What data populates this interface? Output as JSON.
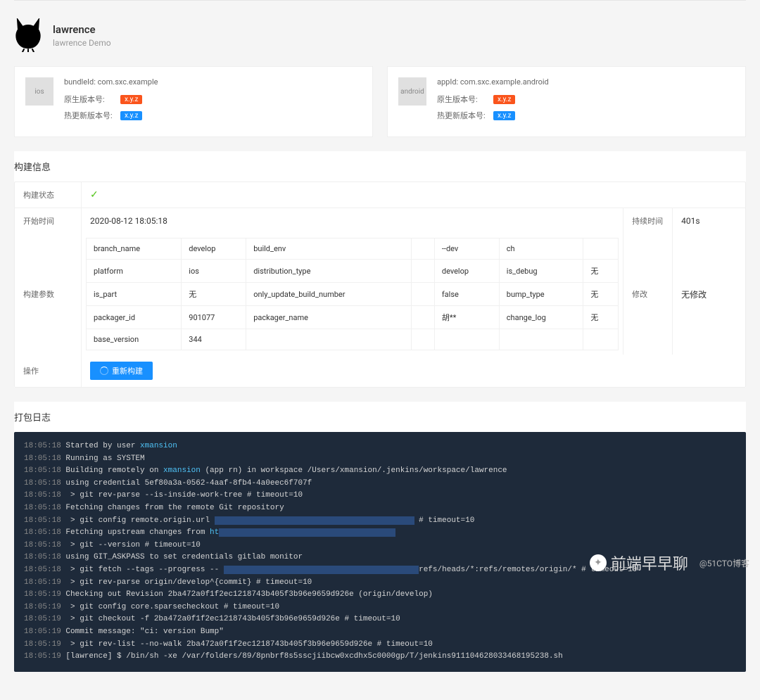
{
  "header": {
    "title": "lawrence",
    "subtitle": "lawrence Demo"
  },
  "platforms": {
    "ios": {
      "icon_label": "ios",
      "bundle_label": "bundleId: com.sxc.example",
      "native_version_label": "原生版本号:",
      "native_version_value": "x.y.z",
      "hot_version_label": "热更新版本号:",
      "hot_version_value": "x.y.z"
    },
    "android": {
      "icon_label": "android",
      "bundle_label": "appId: com.sxc.example.android",
      "native_version_label": "原生版本号:",
      "native_version_value": "x.y.z",
      "hot_version_label": "热更新版本号:",
      "hot_version_value": "x.y.z"
    }
  },
  "build_info": {
    "title": "构建信息",
    "status_label": "构建状态",
    "start_time_label": "开始时间",
    "start_time_value": "2020-08-12 18:05:18",
    "duration_label": "持续时间",
    "duration_value": "401s",
    "params_label": "构建参数",
    "changes_label": "修改",
    "changes_value": "无修改",
    "action_label": "操作",
    "rebuild_label": "重新构建",
    "params": [
      [
        "branch_name",
        "develop",
        "build_env",
        "",
        "--dev",
        "ch",
        ""
      ],
      [
        "platform",
        "ios",
        "distribution_type",
        "",
        "develop",
        "is_debug",
        "无"
      ],
      [
        "is_part",
        "无",
        "only_update_build_number",
        "",
        "false",
        "bump_type",
        "无"
      ],
      [
        "packager_id",
        "901077",
        "packager_name",
        "",
        "胡**",
        "change_log",
        "无"
      ],
      [
        "base_version",
        "344",
        "",
        "",
        "",
        "",
        ""
      ]
    ]
  },
  "logs": {
    "title": "打包日志",
    "lines": [
      {
        "ts": "18:05:18",
        "text": "Started by user ",
        "link": "xmansion"
      },
      {
        "ts": "18:05:18",
        "text": "Running as SYSTEM"
      },
      {
        "ts": "18:05:18",
        "text": "Building remotely on ",
        "link": "xmansion",
        "tail": " (app rn) in workspace /Users/xmansion/.jenkins/workspace/lawrence"
      },
      {
        "ts": "18:05:18",
        "text": "using credential 5ef80a3a-0562-4aaf-8fb4-4a0eec6f707f"
      },
      {
        "ts": "18:05:18",
        "text": " > git rev-parse --is-inside-work-tree # timeout=10"
      },
      {
        "ts": "18:05:18",
        "text": "Fetching changes from the remote Git repository"
      },
      {
        "ts": "18:05:18",
        "text": " > git config remote.origin.url ",
        "redact": "                                           ",
        "tail": " # timeout=10"
      },
      {
        "ts": "18:05:18",
        "text": "Fetching upstream changes from ",
        "link": "ht",
        "redact": "                                      "
      },
      {
        "ts": "18:05:18",
        "text": " > git --version # timeout=10"
      },
      {
        "ts": "18:05:18",
        "text": "using GIT_ASKPASS to set credentials gitlab monitor"
      },
      {
        "ts": "18:05:18",
        "text": " > git fetch --tags --progress -- ",
        "redact": "                                          ",
        "tail": "refs/heads/*:refs/remotes/origin/* # timeout=10"
      },
      {
        "ts": "18:05:19",
        "text": " > git rev-parse origin/develop^{commit} # timeout=10"
      },
      {
        "ts": "18:05:19",
        "text": "Checking out Revision 2ba472a0f1f2ec1218743b405f3b96e9659d926e (origin/develop)"
      },
      {
        "ts": "18:05:19",
        "text": " > git config core.sparsecheckout # timeout=10"
      },
      {
        "ts": "18:05:19",
        "text": " > git checkout -f 2ba472a0f1f2ec1218743b405f3b96e9659d926e # timeout=10"
      },
      {
        "ts": "18:05:19",
        "text": "Commit message: \"ci: version Bump\""
      },
      {
        "ts": "18:05:19",
        "text": " > git rev-list --no-walk 2ba472a0f1f2ec1218743b405f3b96e9659d926e # timeout=10"
      },
      {
        "ts": "18:05:19",
        "text": "[lawrence] $ /bin/sh -xe /var/folders/89/8pnbrf8s5sscjiibcw0xcdhx5c0000gp/T/jenkins911104628033468195238.sh"
      }
    ]
  },
  "watermark": {
    "brand": "前端早早聊",
    "cto": "@51CTO博客"
  }
}
